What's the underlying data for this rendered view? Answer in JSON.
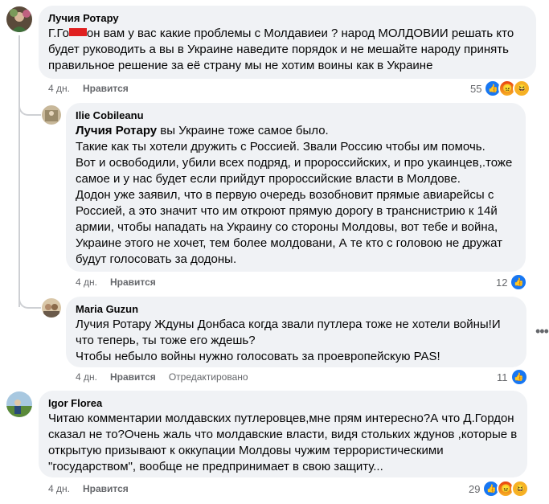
{
  "comments": [
    {
      "author": "Лучия Ротару",
      "text_pre": "Г.Го",
      "text_rest": "он вам у вас какие проблемы с Молдавиеи ? народ МОЛДОВИИ решать кто\nбудет руководить а вы в Украине наведите порядок и не мешайте народу принять\nправильное решение за её страну мы не хотим воины как в Украине",
      "time": "4 дн.",
      "like_label": "Нравится",
      "reaction_count": "55",
      "reactions": [
        "like-icon",
        "angry-icon",
        "haha-icon"
      ]
    },
    {
      "author": "Ilie Cobileanu",
      "mention": "Лучия Ротару",
      "text_first": " вы Украине тоже самое было.",
      "text": "Такие как ты хотели дружить с Россией. Звали Россию чтобы им помочь.\nВот и освободили, убили всех подряд, и пророссийских, и про укаинцев,.тоже\nсамое и у нас будет если прийдут пророссийские власти в Молдове.\nДодон уже заявил, что в первую очередь возобновит прямые авиарейсы с\nРоссией, а это значит что им откроют прямую дорогу в транснистрию к 14й\nармии, чтобы нападать на Украину со стороны Молдовы, вот тебе и война,\nУкраине этого не хочет, тем более молдовани, А те кто с головою не дружат\nбудут голосовать за додоны.",
      "time": "4 дн.",
      "like_label": "Нравится",
      "reaction_count": "12",
      "reactions": [
        "like-icon"
      ]
    },
    {
      "author": "Maria Guzun",
      "text": "Лучия Ротару Ждуны Донбаса когда звали путлера тоже не хотели войны!И\nчто теперь, ты тоже его ждешь?\nЧтобы небыло войны нужно голосовать за проевропейскую PAS!",
      "time": "4 дн.",
      "like_label": "Нравится",
      "edited_label": "Отредактировано",
      "reaction_count": "11",
      "reactions": [
        "like-icon"
      ]
    },
    {
      "author": "Igor Florea",
      "text": "Читаю комментарии молдавских путлеровцев,мне прям интересно?А что Д.Гордон\nсказал не то?Очень жаль что молдавские власти, видя стольких ждунов ,которые в\nоткрытую призывают к оккупации Молдовы чужим террористическими\n\"государством\", вообще не предпринимает в свою защиту...",
      "time": "4 дн.",
      "like_label": "Нравится",
      "reaction_count": "29",
      "reactions": [
        "like-icon",
        "angry-icon",
        "haha-icon"
      ]
    }
  ],
  "colors": {
    "bubble": "#f0f2f5",
    "like": "#1877f2",
    "meta": "#65676b"
  },
  "icons": {
    "more": "more-options-icon"
  }
}
